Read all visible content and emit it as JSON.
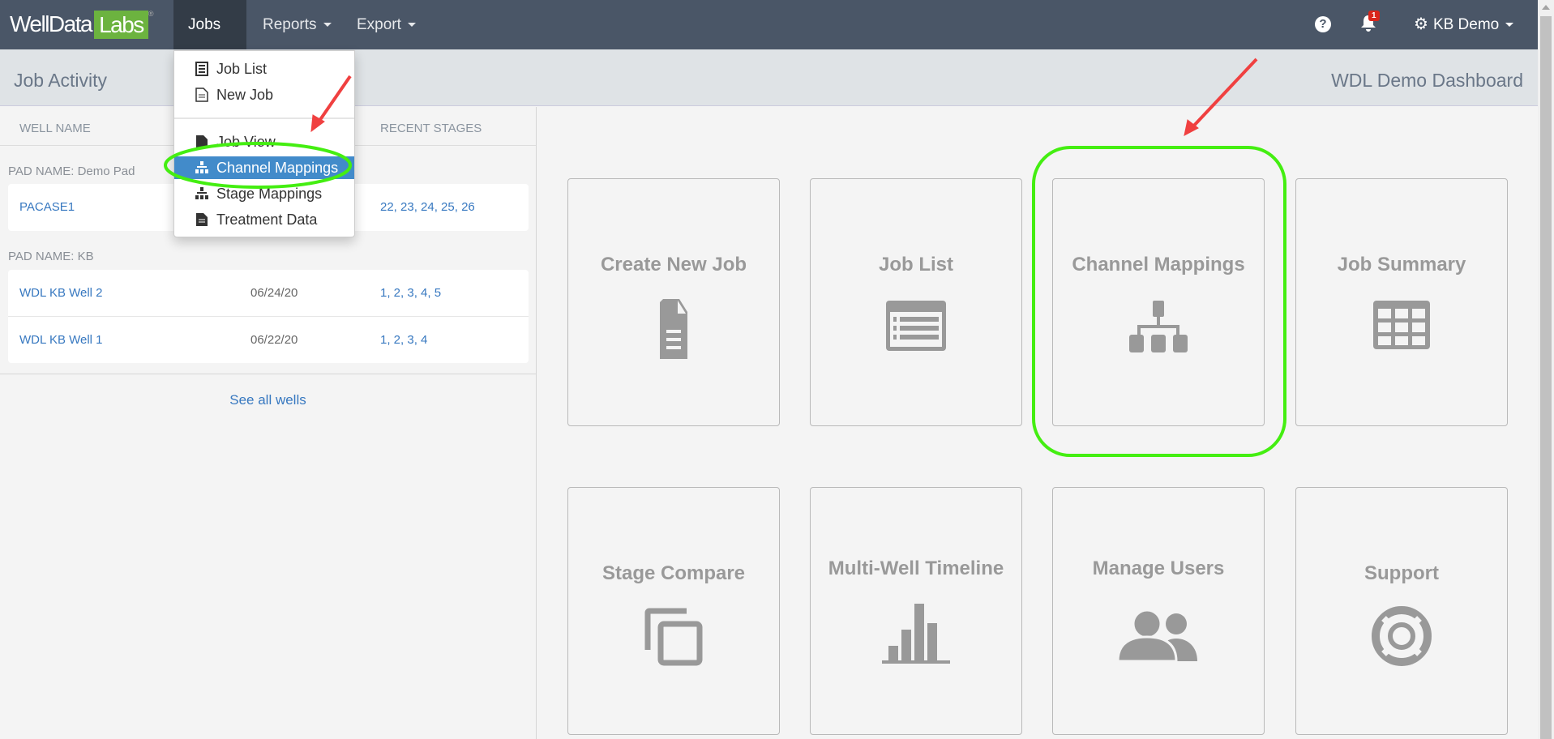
{
  "navbar": {
    "logo_main": "WellData",
    "logo_box": "Labs",
    "logo_mark": "®",
    "menus": [
      "Jobs",
      "Reports",
      "Export"
    ],
    "notification_count": "1",
    "user": "KB Demo"
  },
  "subheader": {
    "left_title": "Job Activity",
    "right_title": "WDL Demo Dashboard"
  },
  "jobs_menu": {
    "items": [
      "Job List",
      "New Job",
      "Job View",
      "Channel Mappings",
      "Stage Mappings",
      "Treatment Data"
    ],
    "selected": "Channel Mappings"
  },
  "activity": {
    "columns": [
      "WELL NAME",
      "RECENT STAGES"
    ],
    "pads": [
      {
        "label": "PAD NAME: Demo Pad",
        "rows": [
          {
            "well": "PACASE1",
            "date": "",
            "stages": "22, 23, 24, 25, 26"
          }
        ]
      },
      {
        "label": "PAD NAME: KB",
        "rows": [
          {
            "well": "WDL KB Well 2",
            "date": "06/24/20",
            "stages": "1, 2, 3, 4, 5"
          },
          {
            "well": "WDL KB Well 1",
            "date": "06/22/20",
            "stages": "1, 2, 3, 4"
          }
        ]
      }
    ],
    "see_all": "See all wells"
  },
  "tiles": [
    "Create New Job",
    "Job List",
    "Channel Mappings",
    "Job Summary",
    "Stage Compare",
    "Multi-Well Timeline",
    "Manage Users",
    "Support"
  ],
  "colors": {
    "navbar": "#4a5667",
    "accent": "#428bca",
    "logo_green": "#6cb33f",
    "annotation_green": "#44ee11",
    "annotation_red": "#f04040"
  }
}
